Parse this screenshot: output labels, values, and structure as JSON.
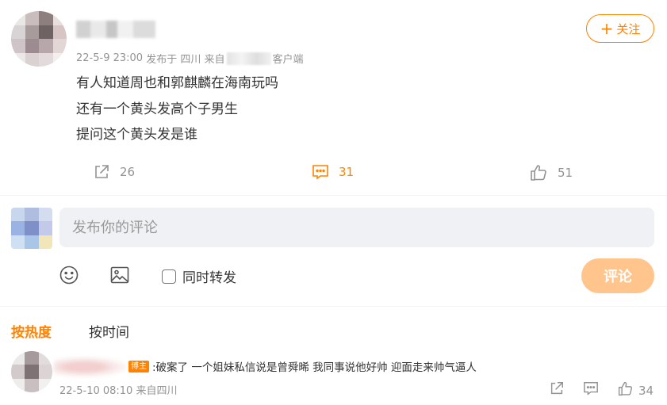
{
  "post": {
    "author_name_blurred": "",
    "follow_button": "关注",
    "meta": {
      "date_time": "22-5-9 23:00",
      "posted_in_prefix": "发布于",
      "location": "四川",
      "from_prefix": "来自",
      "client_suffix": "客户端"
    },
    "content_lines": [
      "有人知道周也和郭麒麟在海南玩吗",
      "还有一个黄头发高个子男生",
      "提问这个黄头发是谁"
    ],
    "actions": {
      "repost_count": "26",
      "comment_count": "31",
      "like_count": "51"
    }
  },
  "composer": {
    "placeholder": "发布你的评论",
    "emoji_icon": "emoji-icon",
    "image_icon": "image-icon",
    "repost_label": "同时转发",
    "submit_label": "评论"
  },
  "sort_tabs": {
    "hot": "按热度",
    "time": "按时间"
  },
  "comments": [
    {
      "badge": "博主",
      "text": ":破案了  一个姐妹私信说是曾舜晞 我同事说他好帅  迎面走来帅气逼人",
      "meta": "22-5-10 08:10 来自四川",
      "like_count": "34"
    }
  ],
  "colors": {
    "accent": "#ff8200",
    "submit_disabled": "#ffc58c",
    "muted_text": "#939393",
    "input_bg": "#f0f1f4"
  }
}
